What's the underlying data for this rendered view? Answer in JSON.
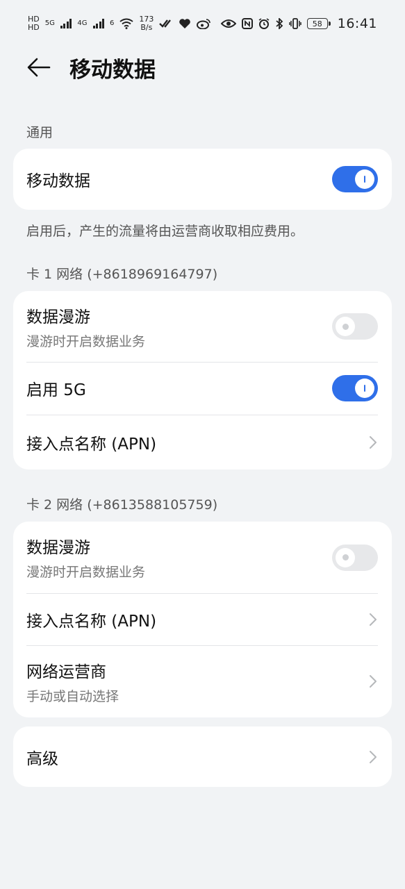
{
  "status_bar": {
    "left_labels": [
      "HD",
      "5G",
      "4G",
      "6"
    ],
    "speed_value": "173",
    "speed_unit": "B/s",
    "battery": "58",
    "time": "16:41"
  },
  "header": {
    "title": "移动数据"
  },
  "general": {
    "section_label": "通用",
    "mobile_data_label": "移动数据",
    "mobile_data_on": true,
    "note": "启用后，产生的流量将由运营商收取相应费用。"
  },
  "sim1": {
    "section_label": "卡 1 网络 (+8618969164797)",
    "roaming_title": "数据漫游",
    "roaming_sub": "漫游时开启数据业务",
    "roaming_on": false,
    "enable5g_title": "启用 5G",
    "enable5g_on": true,
    "apn_title": "接入点名称 (APN)"
  },
  "sim2": {
    "section_label": "卡 2 网络 (+8613588105759)",
    "roaming_title": "数据漫游",
    "roaming_sub": "漫游时开启数据业务",
    "roaming_on": false,
    "apn_title": "接入点名称 (APN)",
    "operator_title": "网络运营商",
    "operator_sub": "手动或自动选择"
  },
  "advanced": {
    "title": "高级"
  },
  "colors": {
    "accent": "#2f6fe9",
    "background": "#f1f3f5",
    "card": "#ffffff"
  },
  "icons": {
    "back": "arrow-left-icon",
    "chevron": "chevron-right-icon"
  }
}
